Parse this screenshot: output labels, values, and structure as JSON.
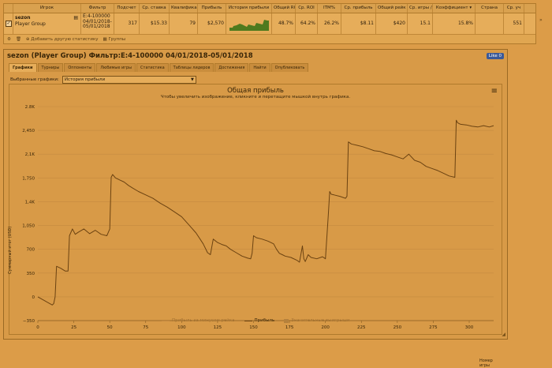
{
  "table": {
    "columns": [
      "Игрок",
      "Фильтр",
      "Подсчет",
      "Ср. ставка",
      "Квалификац",
      "Прибыль",
      "История прибыли",
      "Общий ROI",
      "Ср. ROI",
      "ITM%",
      "Ср. прибыль",
      "Общий рейк",
      "Ср. игры /...",
      "Коэффициент ▾",
      "Страна",
      "Ср. уч"
    ],
    "row": {
      "player_name": "sezon",
      "player_group": "Player Group",
      "filter_lines": [
        "E:4-100000",
        "04/01/2018-",
        "05/01/2018"
      ],
      "count": "317",
      "avg_stake": "$15.33",
      "qualified": "79",
      "profit": "$2,570",
      "total_roi": "48.7%",
      "avg_roi": "64.2%",
      "itm": "26.2%",
      "avg_profit": "$8.11",
      "total_rake": "$420",
      "avg_games": "15.1",
      "coefficient": "15.8%",
      "country": "",
      "avg_part": "551"
    },
    "footer": {
      "add_stats": "Добавить другую статистику",
      "groups": "Группы"
    }
  },
  "panel": {
    "title": "sezon (Player Group) Фильтр:E:4-100000 04/01/2018-05/01/2018",
    "like_label": "Like 0",
    "tabs": [
      "Графики",
      "Турниры",
      "Оппоненты",
      "Любимые игры",
      "Статистика",
      "Таблицы лидеров",
      "Достижения",
      "Найти",
      "Опубликовать"
    ],
    "selector_label": "Выбранные графики:",
    "selector_value": "История прибыли"
  },
  "chart_data": {
    "type": "line",
    "title": "Общая прибыль",
    "subtitle": "Чтобы увеличить изображение, кликните и перетащите мышкой внутрь графика.",
    "xlabel": "Номер игры",
    "ylabel": "Суммарный итог (USD)",
    "xlim": [
      0,
      317
    ],
    "ylim": [
      -350,
      2800
    ],
    "x_ticks": [
      "0",
      "25",
      "50",
      "75",
      "100",
      "125",
      "150",
      "175",
      "200",
      "225",
      "250",
      "275",
      "300"
    ],
    "y_ticks": [
      "−350",
      "0",
      "350",
      "700",
      "1,050",
      "1,4K",
      "1,750",
      "2,1K",
      "2,450",
      "2.8K"
    ],
    "y_tick_values": [
      -350,
      0,
      350,
      700,
      1050,
      1400,
      1750,
      2100,
      2450,
      2800
    ],
    "x_tick_values": [
      0,
      25,
      50,
      75,
      100,
      125,
      150,
      175,
      200,
      225,
      250,
      275,
      300
    ],
    "legend": [
      "Прибыль за минусом рейка",
      "Прибыль",
      "Значительные выигрыши"
    ],
    "series": [
      {
        "name": "Прибыль",
        "color": "#6b4211",
        "x": [
          0,
          5,
          10,
          11,
          12,
          13,
          16,
          19,
          21,
          22,
          24,
          26,
          28,
          32,
          36,
          40,
          44,
          48,
          50,
          51,
          52,
          54,
          57,
          60,
          63,
          66,
          70,
          75,
          80,
          85,
          90,
          95,
          100,
          105,
          110,
          115,
          118,
          120,
          122,
          125,
          128,
          131,
          134,
          138,
          142,
          146,
          148,
          149,
          150,
          152,
          156,
          160,
          162,
          164,
          166,
          168,
          170,
          172,
          176,
          180,
          182,
          184,
          185,
          186,
          188,
          190,
          194,
          198,
          200,
          202,
          203,
          204,
          206,
          210,
          214,
          215,
          216,
          218,
          222,
          226,
          230,
          234,
          238,
          242,
          246,
          250,
          254,
          258,
          262,
          266,
          270,
          274,
          278,
          282,
          286,
          290,
          291,
          292,
          294,
          298,
          302,
          306,
          310,
          314,
          317
        ],
        "y": [
          0,
          -60,
          -120,
          -100,
          0,
          450,
          420,
          380,
          380,
          900,
          1000,
          920,
          950,
          1000,
          930,
          980,
          920,
          900,
          1000,
          1760,
          1800,
          1750,
          1720,
          1690,
          1640,
          1600,
          1550,
          1500,
          1450,
          1380,
          1320,
          1250,
          1180,
          1060,
          940,
          780,
          650,
          620,
          850,
          800,
          770,
          750,
          700,
          650,
          600,
          570,
          560,
          640,
          900,
          870,
          850,
          820,
          800,
          780,
          700,
          640,
          620,
          600,
          580,
          540,
          510,
          750,
          560,
          520,
          620,
          580,
          560,
          590,
          560,
          1200,
          1550,
          1510,
          1500,
          1480,
          1450,
          1480,
          2280,
          2250,
          2230,
          2210,
          2180,
          2150,
          2140,
          2110,
          2090,
          2060,
          2030,
          2100,
          2010,
          1980,
          1920,
          1890,
          1860,
          1820,
          1780,
          1760,
          2600,
          2560,
          2540,
          2530,
          2510,
          2500,
          2520,
          2500,
          2520
        ]
      }
    ]
  }
}
